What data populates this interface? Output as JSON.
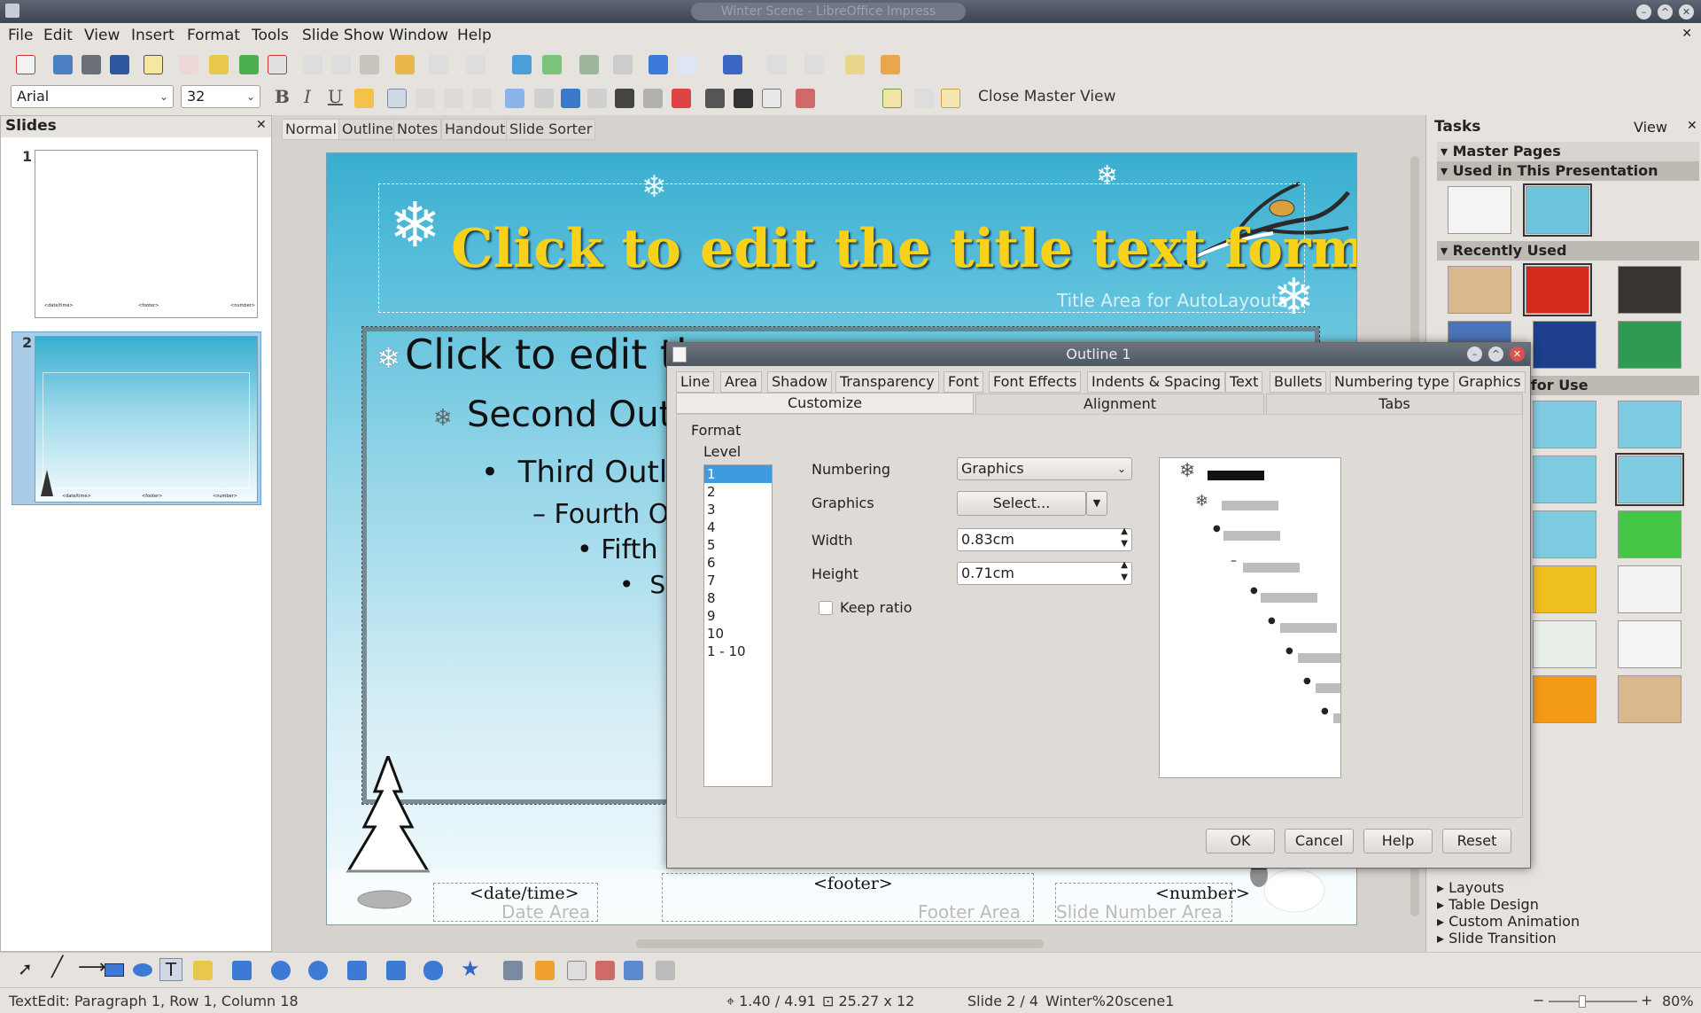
{
  "window": {
    "title": "Winter Scene - LibreOffice Impress"
  },
  "menu": [
    "File",
    "Edit",
    "View",
    "Insert",
    "Format",
    "Tools",
    "Slide Show",
    "Window",
    "Help"
  ],
  "formatting": {
    "font_name": "Arial",
    "font_size": "32",
    "close_master_view": "Close Master View"
  },
  "slides_panel": {
    "title": "Slides",
    "items": [
      {
        "num": "1"
      },
      {
        "num": "2"
      }
    ]
  },
  "view_tabs": [
    "Normal",
    "Outline",
    "Notes",
    "Handout",
    "Slide Sorter"
  ],
  "slide": {
    "title": "Click to edit the title text format",
    "title_area_label": "Title Area for AutoLayouts",
    "outline": [
      "Click to edit th",
      "Second Outli",
      "Third Outlin",
      "Fourth Ou",
      "Fifth O",
      "Si"
    ],
    "footer": {
      "date": "<date/time>",
      "date_area": "Date Area",
      "footer": "<footer>",
      "footer_area": "Footer Area",
      "number": "<number>",
      "number_area": "Slide Number Area"
    },
    "thumb_footers": [
      "<date/time>",
      "<footer>",
      "<number>"
    ]
  },
  "tasks": {
    "title": "Tasks",
    "view_label": "View",
    "master_pages": "Master Pages",
    "used": "Used in This Presentation",
    "recent": "Recently Used",
    "available": "Available for Use",
    "available_partial": "r Use",
    "bottom": [
      "Layouts",
      "Table Design",
      "Custom Animation",
      "Slide Transition"
    ],
    "colors": {
      "used": [
        "#f4f4f4",
        "#6cc4de"
      ],
      "recent": [
        "#d9b98b",
        "#d42a1e",
        "#3a3430",
        "#4a74b8",
        "#1d3f8c",
        "#2f9a52"
      ],
      "available": [
        "#7fcbe2",
        "#7fcbe2",
        "#7fcbe2",
        "#7fcbe2",
        "#7fcbe2",
        "#45c646",
        "#f0c020",
        "#f2f2f2",
        "#e9efe9",
        "#f4f4f4",
        "#f39a18",
        "#d9b98b"
      ]
    }
  },
  "dialog": {
    "title": "Outline 1",
    "tabs": [
      "Line",
      "Area",
      "Shadow",
      "Transparency",
      "Font",
      "Font Effects",
      "Indents & Spacing",
      "Text",
      "Bullets",
      "Numbering type",
      "Graphics"
    ],
    "subtabs": [
      "Customize",
      "Alignment",
      "Tabs"
    ],
    "format_label": "Format",
    "level_label": "Level",
    "levels": [
      "1",
      "2",
      "3",
      "4",
      "5",
      "6",
      "7",
      "8",
      "9",
      "10",
      "1 - 10"
    ],
    "numbering_label": "Numbering",
    "numbering_value": "Graphics",
    "graphics_label": "Graphics",
    "select_label": "Select...",
    "width_label": "Width",
    "width_value": "0.83cm",
    "height_label": "Height",
    "height_value": "0.71cm",
    "keep_ratio": "Keep ratio",
    "buttons": {
      "ok": "OK",
      "cancel": "Cancel",
      "help": "Help",
      "reset": "Reset"
    }
  },
  "status": {
    "edit": "TextEdit: Paragraph 1, Row 1, Column 18",
    "position": "1.40 / 4.91",
    "size": "25.27 x 12",
    "slide": "Slide 2 / 4",
    "master": "Winter%20scene1",
    "zoom": "80%"
  }
}
